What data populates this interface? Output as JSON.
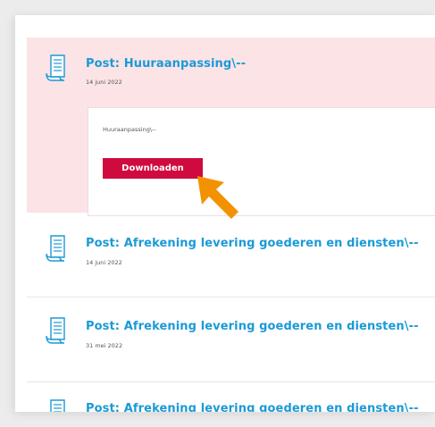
{
  "items": [
    {
      "title": "Post: Huuraanpassing\\--",
      "date": "14 juni 2022",
      "icon": "document-icon",
      "detail": {
        "text": "Huuraanpassing\\--",
        "download_label": "Downloaden"
      }
    },
    {
      "title": "Post: Afrekening levering goederen en diensten\\--",
      "date": "14 juni 2022",
      "icon": "document-icon"
    },
    {
      "title": "Post: Afrekening levering goederen en diensten\\--",
      "date": "31 mei 2022",
      "icon": "document-icon"
    },
    {
      "title": "Post: Afrekening levering goederen en diensten\\--",
      "date": "",
      "icon": "document-icon"
    }
  ],
  "colors": {
    "accent": "#1b9ad6",
    "highlight_bg": "#fbe3e6",
    "button": "#cf0a3f",
    "cursor": "#f39200"
  },
  "cursor_icon": "pointer-arrow-icon"
}
